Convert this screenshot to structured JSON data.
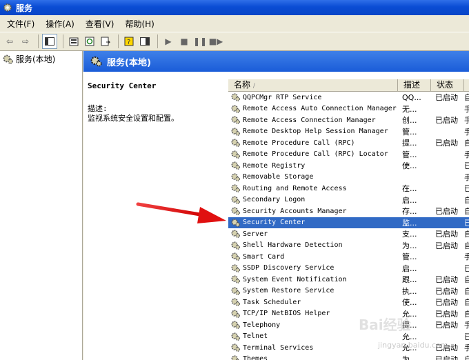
{
  "window": {
    "title": "服务"
  },
  "menu": [
    {
      "label": "文件(F)"
    },
    {
      "label": "操作(A)"
    },
    {
      "label": "查看(V)"
    },
    {
      "label": "帮助(H)"
    }
  ],
  "tree": {
    "root": "服务(本地)"
  },
  "header": {
    "title": "服务(本地)"
  },
  "details": {
    "service_name": "Security Center",
    "desc_label": "描述:",
    "desc_text": "监视系统安全设置和配置。"
  },
  "columns": {
    "name": "名称",
    "desc": "描述",
    "status": "状态"
  },
  "services": [
    {
      "name": "QQPCMgr RTP Service",
      "desc": "QQ...",
      "status": "已启动",
      "startup": "自"
    },
    {
      "name": "Remote Access Auto Connection Manager",
      "desc": "无...",
      "status": "",
      "startup": "手"
    },
    {
      "name": "Remote Access Connection Manager",
      "desc": "创...",
      "status": "已启动",
      "startup": "手"
    },
    {
      "name": "Remote Desktop Help Session Manager",
      "desc": "管...",
      "status": "",
      "startup": "手"
    },
    {
      "name": "Remote Procedure Call (RPC)",
      "desc": "提...",
      "status": "已启动",
      "startup": "自"
    },
    {
      "name": "Remote Procedure Call (RPC) Locator",
      "desc": "管...",
      "status": "",
      "startup": "手"
    },
    {
      "name": "Remote Registry",
      "desc": "使...",
      "status": "",
      "startup": "已"
    },
    {
      "name": "Removable Storage",
      "desc": "",
      "status": "",
      "startup": "手"
    },
    {
      "name": "Routing and Remote Access",
      "desc": "在...",
      "status": "",
      "startup": "已"
    },
    {
      "name": "Secondary Logon",
      "desc": "启...",
      "status": "",
      "startup": "自"
    },
    {
      "name": "Security Accounts Manager",
      "desc": "存...",
      "status": "已启动",
      "startup": "自"
    },
    {
      "name": "Security Center",
      "desc": "监...",
      "status": "",
      "startup": "已",
      "selected": true
    },
    {
      "name": "Server",
      "desc": "支...",
      "status": "已启动",
      "startup": "自"
    },
    {
      "name": "Shell Hardware Detection",
      "desc": "为...",
      "status": "已启动",
      "startup": "自"
    },
    {
      "name": "Smart Card",
      "desc": "管...",
      "status": "",
      "startup": "手"
    },
    {
      "name": "SSDP Discovery Service",
      "desc": "启...",
      "status": "",
      "startup": "已"
    },
    {
      "name": "System Event Notification",
      "desc": "跟...",
      "status": "已启动",
      "startup": "自"
    },
    {
      "name": "System Restore Service",
      "desc": "执...",
      "status": "已启动",
      "startup": "自"
    },
    {
      "name": "Task Scheduler",
      "desc": "使...",
      "status": "已启动",
      "startup": "自"
    },
    {
      "name": "TCP/IP NetBIOS Helper",
      "desc": "允...",
      "status": "已启动",
      "startup": "自"
    },
    {
      "name": "Telephony",
      "desc": "提...",
      "status": "已启动",
      "startup": "手"
    },
    {
      "name": "Telnet",
      "desc": "允...",
      "status": "",
      "startup": "已"
    },
    {
      "name": "Terminal Services",
      "desc": "允...",
      "status": "已启动",
      "startup": "手"
    },
    {
      "name": "Themes",
      "desc": "为...",
      "status": "已启动",
      "startup": "自"
    }
  ],
  "watermark": {
    "logo": "Bai经验",
    "url": "jingyan.baidu.com"
  },
  "colors": {
    "title_bar": "#0a4cd4",
    "header": "#2a6be0",
    "selection": "#316ac5",
    "arrow": "#e01010"
  }
}
